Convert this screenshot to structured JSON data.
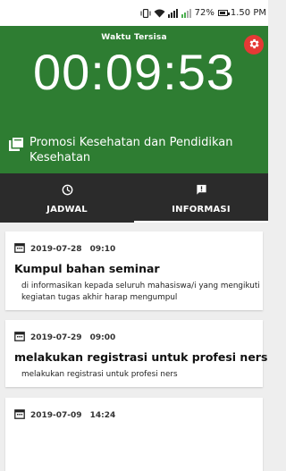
{
  "status_bar": {
    "battery": "72%",
    "time": "1.50 PM"
  },
  "hero": {
    "label": "Waktu Tersisa",
    "timer": "00:09:53",
    "course_title": "Promosi Kesehatan dan Pendidikan Kesehatan",
    "bg_color": "#2e7d32",
    "settings_color": "#e53935"
  },
  "tabs": [
    {
      "label": "JADWAL",
      "icon": "clock-icon",
      "active": false
    },
    {
      "label": "INFORMASI",
      "icon": "alert-icon",
      "active": true
    }
  ],
  "announcements": [
    {
      "date": "2019-07-28",
      "time": "09:10",
      "title": "Kumpul bahan seminar",
      "body": "di informasikan kepada seluruh mahasiswa/i yang mengikuti kegiatan tugas akhir harap mengumpul"
    },
    {
      "date": "2019-07-29",
      "time": "09:00",
      "title": "melakukan registrasi untuk profesi ners",
      "body": "melakukan registrasi untuk profesi ners"
    },
    {
      "date": "2019-07-09",
      "time": "14:24",
      "title": "",
      "body": ""
    }
  ]
}
